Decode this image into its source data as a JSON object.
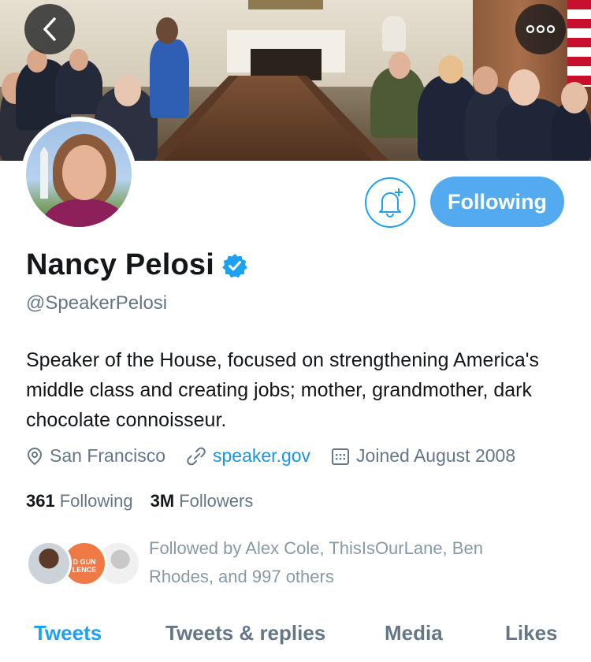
{
  "header": {
    "back_icon": "chevron-left-icon",
    "more_icon": "more-horizontal-icon",
    "banner_description": "cabinet-room-meeting-photo"
  },
  "actions": {
    "notifications_icon": "bell-plus-icon",
    "follow_label": "Following"
  },
  "profile": {
    "name": "Nancy Pelosi",
    "verified_icon": "verified-badge-icon",
    "handle": "@SpeakerPelosi",
    "bio": "Speaker of the House, focused on strengthening America's middle class and creating jobs; mother, grandmother, dark chocolate connoisseur.",
    "location": "San Francisco",
    "website": "speaker.gov",
    "joined": "Joined August 2008"
  },
  "stats": {
    "following_count": "361",
    "following_label": "Following",
    "followers_count": "3M",
    "followers_label": "Followers"
  },
  "followed_by": {
    "text": "Followed by Alex Cole, ThisIsOurLane, Ben Rhodes, and 997 others",
    "badge_text": "D GUN LENCE"
  },
  "tabs": [
    {
      "label": "Tweets",
      "active": true
    },
    {
      "label": "Tweets & replies",
      "active": false
    },
    {
      "label": "Media",
      "active": false
    },
    {
      "label": "Likes",
      "active": false
    }
  ],
  "colors": {
    "accent": "#1da1f2",
    "follow_button": "#54aaef",
    "secondary_text": "#657786",
    "primary_text": "#14171a"
  }
}
